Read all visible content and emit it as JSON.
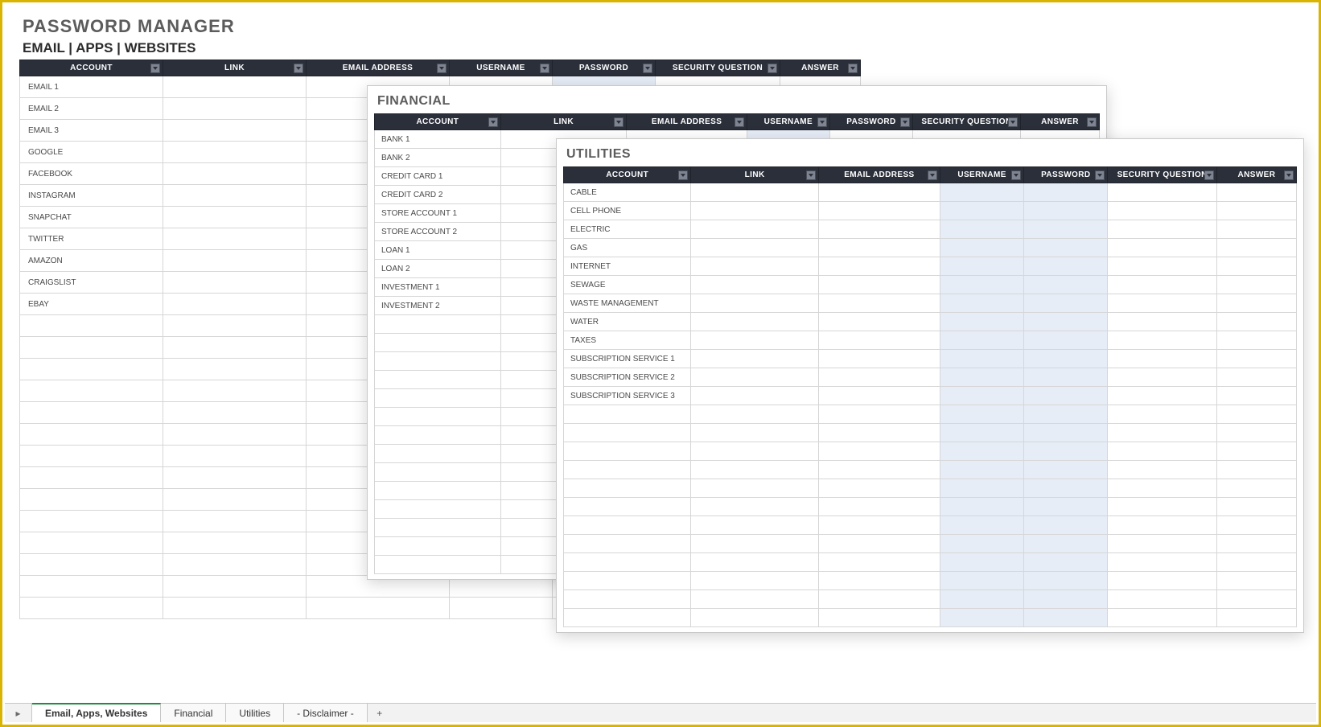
{
  "title": "PASSWORD MANAGER",
  "subtitle": "EMAIL | APPS | WEBSITES",
  "columns": [
    "ACCOUNT",
    "LINK",
    "EMAIL ADDRESS",
    "USERNAME",
    "PASSWORD",
    "SECURITY QUESTION",
    "ANSWER"
  ],
  "main": {
    "rows": [
      "EMAIL 1",
      "EMAIL 2",
      "EMAIL 3",
      "GOOGLE",
      "FACEBOOK",
      "INSTAGRAM",
      "SNAPCHAT",
      "TWITTER",
      "AMAZON",
      "CRAIGSLIST",
      "EBAY",
      "",
      "",
      "",
      "",
      "",
      "",
      "",
      "",
      "",
      "",
      "",
      "",
      "",
      ""
    ],
    "tint_cols": [
      4
    ],
    "tint_row_max": 0
  },
  "financial": {
    "title": "FINANCIAL",
    "rows": [
      "BANK 1",
      "BANK 2",
      "CREDIT CARD 1",
      "CREDIT CARD 2",
      "STORE ACCOUNT 1",
      "STORE ACCOUNT 2",
      "LOAN 1",
      "LOAN 2",
      "INVESTMENT 1",
      "INVESTMENT 2",
      "",
      "",
      "",
      "",
      "",
      "",
      "",
      "",
      "",
      "",
      "",
      "",
      "",
      ""
    ],
    "tint_cols": [
      3
    ],
    "tint_row_max": 0
  },
  "utilities": {
    "title": "UTILITIES",
    "rows": [
      "CABLE",
      "CELL PHONE",
      "ELECTRIC",
      "GAS",
      "INTERNET",
      "SEWAGE",
      "WASTE MANAGEMENT",
      "WATER",
      "TAXES",
      "SUBSCRIPTION SERVICE 1",
      "SUBSCRIPTION SERVICE 2",
      "SUBSCRIPTION SERVICE 3",
      "",
      "",
      "",
      "",
      "",
      "",
      "",
      "",
      "",
      "",
      "",
      ""
    ],
    "tint_cols": [
      3,
      4
    ],
    "tint_row_max": 23
  },
  "tabs": {
    "items": [
      "Email, Apps, Websites",
      "Financial",
      "Utilities",
      "- Disclaimer -"
    ],
    "active": 0,
    "add": "+"
  }
}
